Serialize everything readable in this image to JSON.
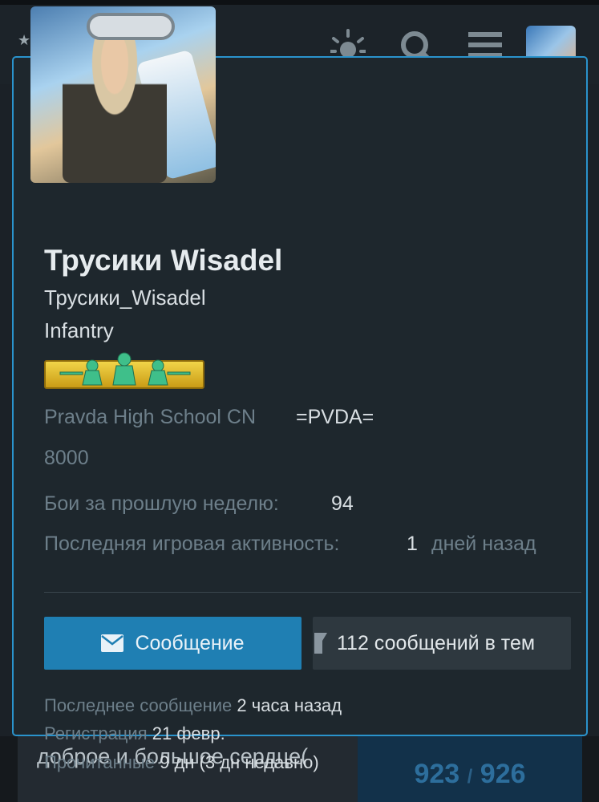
{
  "header": {
    "star": "★",
    "icons": [
      "sun-icon",
      "search-icon",
      "menu-icon"
    ]
  },
  "profile": {
    "display_name": "Трусики Wisadel",
    "username": "Трусики_Wisadel",
    "role": "Infantry",
    "clan_name": "Pravda High School CN",
    "clan_tag": "=PVDA=",
    "rating": "8000",
    "battles_label": "Бои за прошлую неделю",
    "battles_value": "94",
    "activity_label": "Последняя игровая активность",
    "activity_value": "1",
    "activity_unit": "дней назад"
  },
  "actions": {
    "message_label": "Сообщение",
    "posts_label": "112 сообщений в тем"
  },
  "meta": {
    "last_post_label": "Последнее сообщение",
    "last_post_value": "2 часа назад",
    "registered_label": "Регистрация",
    "registered_value": "21 февр.",
    "read_label": "Прочитанные",
    "read_value": "9 дн (3 дн недавно)"
  },
  "background": {
    "post_snippet": "доброе и большое сердце(",
    "counter_current": "923",
    "counter_sep": "/",
    "counter_total": "926"
  },
  "colors": {
    "accent": "#1f7fb3",
    "card_border": "#2a93cc",
    "badge_gold": "#e3c02a",
    "badge_green": "#3fbf8a"
  }
}
